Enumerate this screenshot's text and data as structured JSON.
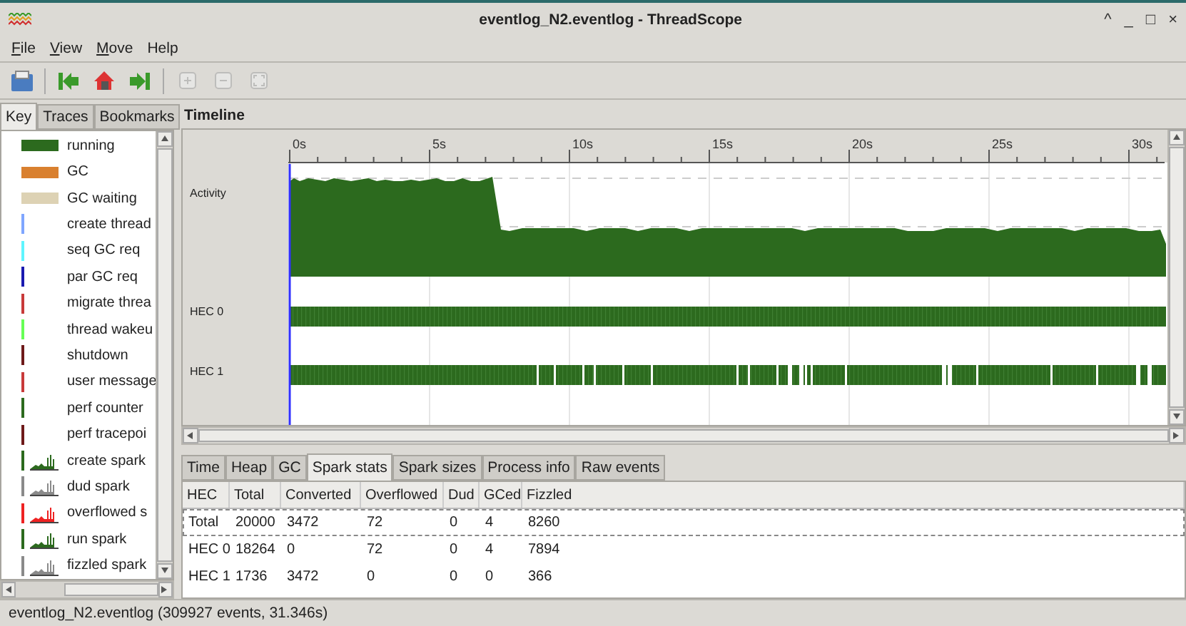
{
  "window": {
    "title": "eventlog_N2.eventlog - ThreadScope",
    "controls": [
      "^",
      "_",
      "□",
      "×"
    ]
  },
  "menu": [
    {
      "label": "File",
      "mnemonic": true
    },
    {
      "label": "View",
      "mnemonic": true
    },
    {
      "label": "Move",
      "mnemonic": true
    },
    {
      "label": "Help",
      "mnemonic": false
    }
  ],
  "toolbar": [
    {
      "kind": "open",
      "disabled": false
    },
    {
      "kind": "sep"
    },
    {
      "kind": "start",
      "disabled": false
    },
    {
      "kind": "home",
      "disabled": false
    },
    {
      "kind": "end",
      "disabled": false
    },
    {
      "kind": "sep"
    },
    {
      "kind": "zoomin",
      "disabled": true
    },
    {
      "kind": "zoomout",
      "disabled": true
    },
    {
      "kind": "fit",
      "disabled": true
    }
  ],
  "side_tabs": [
    {
      "label": "Key",
      "selected": true
    },
    {
      "label": "Traces",
      "selected": false
    },
    {
      "label": "Bookmarks",
      "selected": false
    }
  ],
  "key": [
    {
      "kind": "bar",
      "color": "#2c6a1e",
      "label": "running"
    },
    {
      "kind": "bar",
      "color": "#d9802f",
      "label": "GC"
    },
    {
      "kind": "bar",
      "color": "#ddd2b4",
      "label": "GC waiting"
    },
    {
      "kind": "line",
      "color": "#7fa6ff",
      "label": "create thread"
    },
    {
      "kind": "line",
      "color": "#5ff5ff",
      "label": "seq GC req"
    },
    {
      "kind": "line",
      "color": "#1a1ab0",
      "label": "par GC req"
    },
    {
      "kind": "line",
      "color": "#c83a3a",
      "label": "migrate threa"
    },
    {
      "kind": "line",
      "color": "#66ff55",
      "label": "thread wakeu"
    },
    {
      "kind": "line",
      "color": "#6e1a1a",
      "label": "shutdown"
    },
    {
      "kind": "line",
      "color": "#c83a3a",
      "label": "user message"
    },
    {
      "kind": "line",
      "color": "#2c6a1e",
      "label": "perf counter"
    },
    {
      "kind": "line",
      "color": "#6e1a1a",
      "label": "perf tracepoi"
    },
    {
      "kind": "spark",
      "color": "#2c6a1e",
      "label": "create spark"
    },
    {
      "kind": "spark",
      "color": "#8a8a8a",
      "label": "dud spark"
    },
    {
      "kind": "spark",
      "color": "#ee2222",
      "label": "overflowed s"
    },
    {
      "kind": "spark",
      "color": "#2c6a1e",
      "label": "run spark"
    },
    {
      "kind": "spark",
      "color": "#8a8a8a",
      "label": "fizzled spark"
    }
  ],
  "timeline": {
    "title": "Timeline",
    "ticks": [
      "0s",
      "5s",
      "10s",
      "15s",
      "20s",
      "25s",
      "30s"
    ],
    "tracks": [
      {
        "kind": "activity",
        "label": "Activity"
      },
      {
        "kind": "hec",
        "label": "HEC 0",
        "gaps": false
      },
      {
        "kind": "hec",
        "label": "HEC 1",
        "gaps": true
      }
    ]
  },
  "bottom_tabs": [
    {
      "label": "Time",
      "selected": false
    },
    {
      "label": "Heap",
      "selected": false
    },
    {
      "label": "GC",
      "selected": false
    },
    {
      "label": "Spark stats",
      "selected": true
    },
    {
      "label": "Spark sizes",
      "selected": false
    },
    {
      "label": "Process info",
      "selected": false
    },
    {
      "label": "Raw events",
      "selected": false
    }
  ],
  "table": {
    "columns": [
      "HEC",
      "Total",
      "Converted",
      "Overflowed",
      "Dud",
      "GCed",
      "Fizzled"
    ],
    "rows": [
      {
        "selected": true,
        "cells": [
          "Total",
          "20000",
          "3472",
          "72",
          "0",
          "4",
          "8260"
        ]
      },
      {
        "selected": false,
        "cells": [
          "HEC 0",
          "18264",
          "0",
          "72",
          "0",
          "4",
          "7894"
        ]
      },
      {
        "selected": false,
        "cells": [
          "HEC 1",
          "1736",
          "3472",
          "0",
          "0",
          "0",
          "366"
        ]
      }
    ]
  },
  "status_bar": "eventlog_N2.eventlog (309927 events, 31.346s)"
}
